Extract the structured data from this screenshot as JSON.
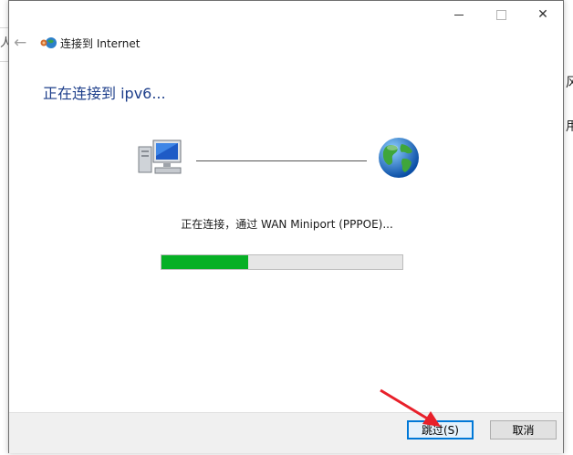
{
  "window": {
    "title": "连接到 Internet",
    "minimize_label": "minimize",
    "maximize_label": "maximize",
    "close_glyph": "✕"
  },
  "background": {
    "left_char": "人",
    "right_chars": [
      "风",
      "用"
    ]
  },
  "main": {
    "heading": "正在连接到 ipv6...",
    "status": "正在连接，通过 WAN Miniport (PPPOE)...",
    "progress_fraction": 0.36,
    "progress_color": "#06b025",
    "source_icon": "computer-icon",
    "target_icon": "globe-icon"
  },
  "buttons": {
    "skip": "跳过(S)",
    "cancel": "取消"
  },
  "colors": {
    "heading": "#1d3e8a",
    "annotation_arrow": "#e8202a",
    "focus_border": "#0078d7"
  }
}
